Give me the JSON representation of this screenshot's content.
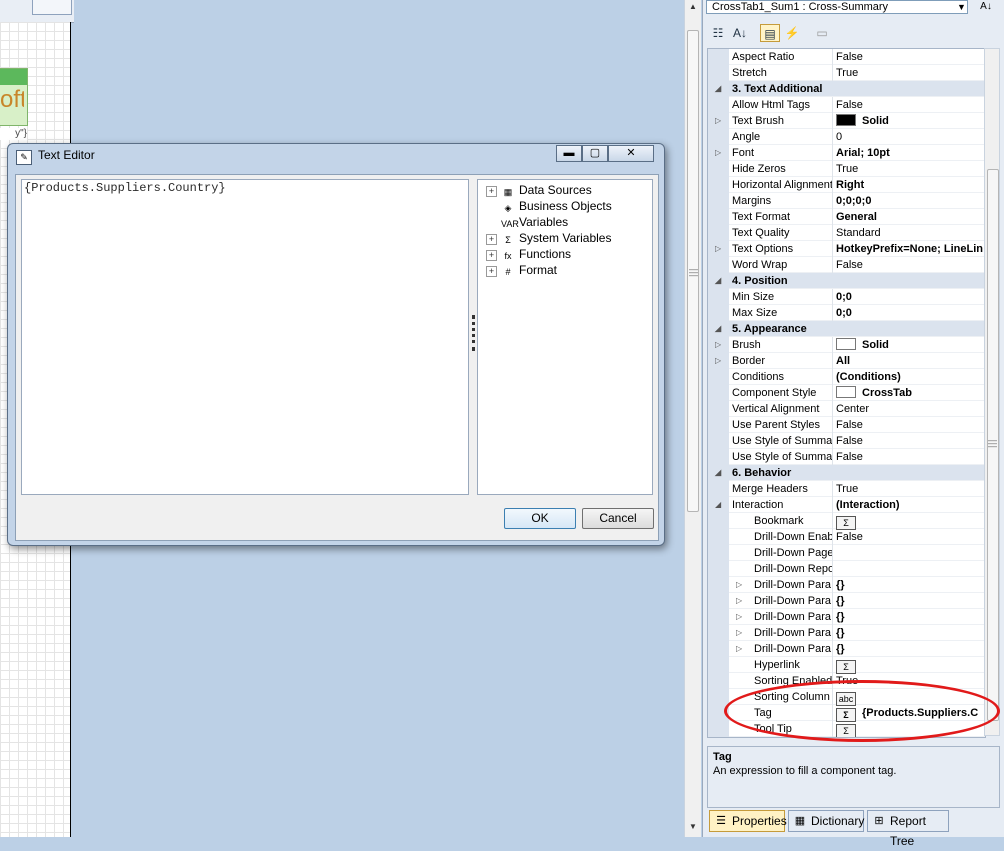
{
  "properties_panel": {
    "component_selector": "CrossTab1_Sum1 : Cross-Summary",
    "rows": [
      {
        "type": "prop",
        "name": "Aspect Ratio",
        "value": "False"
      },
      {
        "type": "prop",
        "name": "Stretch",
        "value": "True"
      },
      {
        "type": "cat",
        "name": "3. Text  Additional"
      },
      {
        "type": "prop",
        "name": "Allow Html Tags",
        "value": "False"
      },
      {
        "type": "prop",
        "name": "Text Brush",
        "value": "Solid",
        "bold": true,
        "swatch": "#000000",
        "expand": true
      },
      {
        "type": "prop",
        "name": "Angle",
        "value": "0"
      },
      {
        "type": "prop",
        "name": "Font",
        "value": "Arial; 10pt",
        "bold": true,
        "expand": true
      },
      {
        "type": "prop",
        "name": "Hide Zeros",
        "value": "True"
      },
      {
        "type": "prop",
        "name": "Horizontal Alignment",
        "value": "Right",
        "bold": true
      },
      {
        "type": "prop",
        "name": "Margins",
        "value": "0;0;0;0",
        "bold": true
      },
      {
        "type": "prop",
        "name": "Text Format",
        "value": "General",
        "bold": true
      },
      {
        "type": "prop",
        "name": "Text Quality",
        "value": "Standard"
      },
      {
        "type": "prop",
        "name": "Text Options",
        "value": "HotkeyPrefix=None; LineLin",
        "bold": true,
        "expand": true
      },
      {
        "type": "prop",
        "name": "Word Wrap",
        "value": "False"
      },
      {
        "type": "cat",
        "name": "4. Position"
      },
      {
        "type": "prop",
        "name": "Min Size",
        "value": "0;0",
        "bold": true
      },
      {
        "type": "prop",
        "name": "Max Size",
        "value": "0;0",
        "bold": true
      },
      {
        "type": "cat",
        "name": "5. Appearance"
      },
      {
        "type": "prop",
        "name": "Brush",
        "value": "Solid",
        "bold": true,
        "swatch": "#ffffff",
        "expand": true
      },
      {
        "type": "prop",
        "name": "Border",
        "value": "All",
        "bold": true,
        "expand": true
      },
      {
        "type": "prop",
        "name": "Conditions",
        "value": "(Conditions)",
        "bold": true
      },
      {
        "type": "prop",
        "name": "Component Style",
        "value": "CrossTab",
        "bold": true,
        "swatch": "#ffffff"
      },
      {
        "type": "prop",
        "name": "Vertical Alignment",
        "value": "Center"
      },
      {
        "type": "prop",
        "name": "Use Parent Styles",
        "value": "False"
      },
      {
        "type": "prop",
        "name": "Use Style of Summa",
        "value": "False"
      },
      {
        "type": "prop",
        "name": "Use Style of Summa",
        "value": "False"
      },
      {
        "type": "cat",
        "name": "6. Behavior"
      },
      {
        "type": "prop",
        "name": "Merge Headers",
        "value": "True"
      },
      {
        "type": "prop",
        "name": "Interaction",
        "value": "(Interaction)",
        "bold": true,
        "collapse": true
      },
      {
        "type": "sub",
        "name": "Bookmark",
        "value": "",
        "sigma": true
      },
      {
        "type": "sub",
        "name": "Drill-Down Enab",
        "value": "False"
      },
      {
        "type": "sub",
        "name": "Drill-Down Page",
        "value": ""
      },
      {
        "type": "sub",
        "name": "Drill-Down Repo",
        "value": ""
      },
      {
        "type": "sub",
        "name": "Drill-Down Para",
        "value": "{}",
        "bold": true,
        "expand": true
      },
      {
        "type": "sub",
        "name": "Drill-Down Para",
        "value": "{}",
        "bold": true,
        "expand": true
      },
      {
        "type": "sub",
        "name": "Drill-Down Para",
        "value": "{}",
        "bold": true,
        "expand": true
      },
      {
        "type": "sub",
        "name": "Drill-Down Para",
        "value": "{}",
        "bold": true,
        "expand": true
      },
      {
        "type": "sub",
        "name": "Drill-Down Para",
        "value": "{}",
        "bold": true,
        "expand": true
      },
      {
        "type": "sub",
        "name": "Hyperlink",
        "value": "",
        "sigma": true
      },
      {
        "type": "sub",
        "name": "Sorting Enabled",
        "value": "True"
      },
      {
        "type": "sub",
        "name": "Sorting Column",
        "value": "",
        "abc": true
      },
      {
        "type": "sub",
        "name": "Tag",
        "value": "{Products.Suppliers.C",
        "bold": true,
        "sigma": true
      },
      {
        "type": "sub",
        "name": "Tool Tip",
        "value": "",
        "sigma": true
      }
    ],
    "description": {
      "title": "Tag",
      "text": "An expression to fill a component tag."
    },
    "tabs": [
      {
        "label": "Properties",
        "active": true
      },
      {
        "label": "Dictionary",
        "active": false
      },
      {
        "label": "Report Tree",
        "active": false
      }
    ]
  },
  "text_editor": {
    "title": "Text Editor",
    "expression": "{Products.Suppliers.Country}",
    "tree_items": [
      {
        "label": "Data Sources",
        "expandable": true,
        "icon": "table-icon"
      },
      {
        "label": "Business Objects",
        "expandable": false,
        "icon": "business-object-icon"
      },
      {
        "label": "Variables",
        "expandable": false,
        "icon": "variable-icon"
      },
      {
        "label": "System Variables",
        "expandable": true,
        "icon": "system-variable-icon"
      },
      {
        "label": "Functions",
        "expandable": true,
        "icon": "function-icon"
      },
      {
        "label": "Format",
        "expandable": true,
        "icon": "format-icon"
      }
    ],
    "ok_label": "OK",
    "cancel_label": "Cancel"
  },
  "design_surface": {
    "crosstab_fragment_text": "oft",
    "crosstab_small_text": "y\"}"
  },
  "colors": {
    "highlight": "#e11a1a",
    "background": "#bcd0e6"
  }
}
